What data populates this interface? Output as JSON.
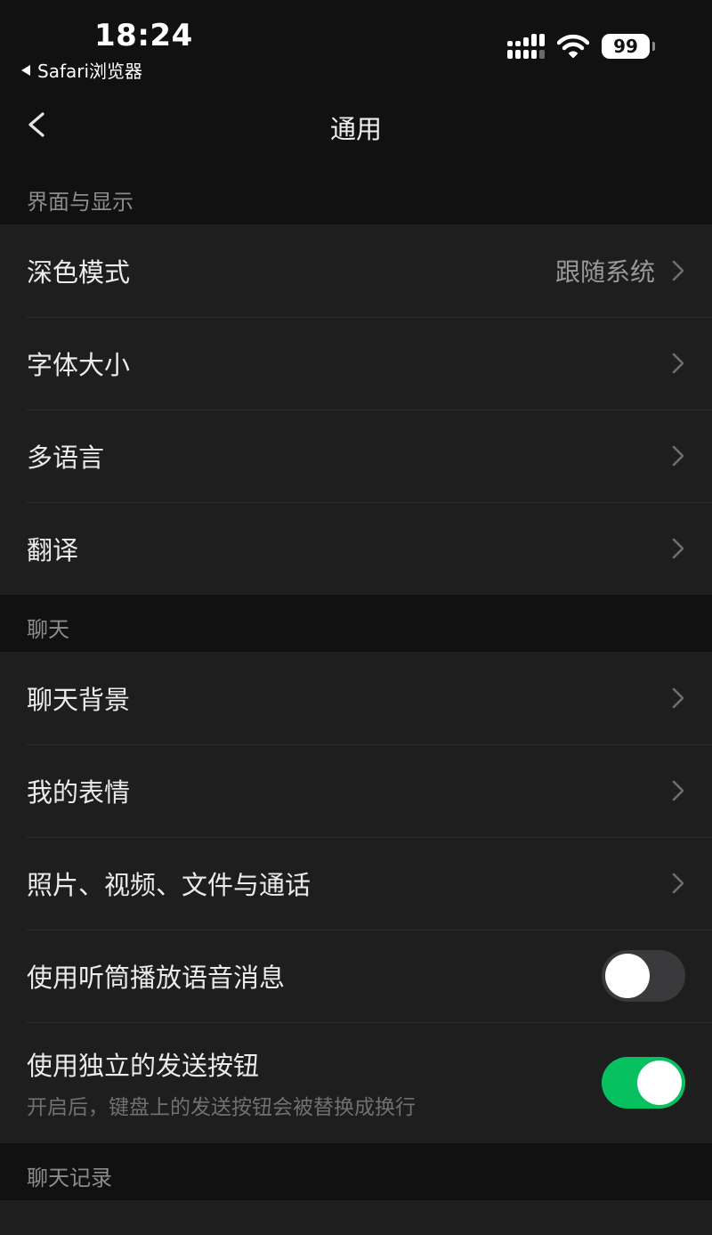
{
  "status_bar": {
    "time": "18:24",
    "back_app": "Safari浏览器",
    "battery": "99"
  },
  "nav": {
    "title": "通用"
  },
  "sections": [
    {
      "header": "界面与显示",
      "rows": [
        {
          "label": "深色模式",
          "value": "跟随系统"
        },
        {
          "label": "字体大小"
        },
        {
          "label": "多语言"
        },
        {
          "label": "翻译"
        }
      ]
    },
    {
      "header": "聊天",
      "rows": [
        {
          "label": "聊天背景"
        },
        {
          "label": "我的表情"
        },
        {
          "label": "照片、视频、文件与通话"
        },
        {
          "label": "使用听筒播放语音消息",
          "toggle": false
        },
        {
          "label": "使用独立的发送按钮",
          "sublabel": "开启后，键盘上的发送按钮会被替换成换行",
          "toggle": true
        }
      ]
    },
    {
      "header": "聊天记录"
    }
  ],
  "colors": {
    "background": "#111111",
    "cell": "#1e1e1e",
    "accent_green": "#07c160"
  }
}
